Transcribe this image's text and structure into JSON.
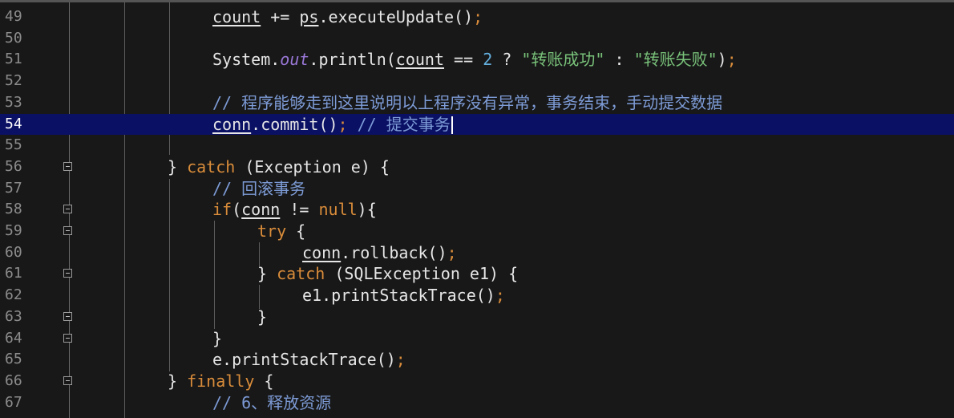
{
  "editor": {
    "current_line": "54",
    "lines": [
      {
        "n": "49",
        "t1": "count",
        "t2": " += ",
        "t3": "ps",
        "t4": ".executeUpdate()",
        "t5": ";"
      },
      {
        "n": "50"
      },
      {
        "n": "51",
        "t1": "System.",
        "t2": "out",
        "t3": ".println(",
        "t4": "count",
        "t5": " == ",
        "t6": "2",
        "t7": " ? ",
        "t8": "\"转账成功\"",
        "t9": " : ",
        "t10": "\"转账失败\"",
        "t11": ")",
        "t12": ";"
      },
      {
        "n": "52"
      },
      {
        "n": "53",
        "c": "// 程序能够走到这里说明以上程序没有异常，事务结束，手动提交数据"
      },
      {
        "n": "54",
        "t1": "conn",
        "t2": ".commit()",
        "t3": ";",
        "c": " // 提交事务"
      },
      {
        "n": "55"
      },
      {
        "n": "56",
        "t1": "} ",
        "t2": "catch",
        "t3": " (Exception e) {"
      },
      {
        "n": "57",
        "c": "// 回滚事务"
      },
      {
        "n": "58",
        "t1": "if",
        "t2": "(",
        "t3": "conn",
        "t4": " != ",
        "t5": "null",
        "t6": "){"
      },
      {
        "n": "59",
        "t1": "try",
        "t2": " {"
      },
      {
        "n": "60",
        "t1": "conn",
        "t2": ".rollback()",
        "t3": ";"
      },
      {
        "n": "61",
        "t1": "} ",
        "t2": "catch",
        "t3": " (SQLException e1) {"
      },
      {
        "n": "62",
        "t1": "e1.printStackTrace()",
        "t2": ";"
      },
      {
        "n": "63",
        "t1": "}"
      },
      {
        "n": "64",
        "t1": "}"
      },
      {
        "n": "65",
        "t1": "e.printStackTrace()",
        "t2": ";"
      },
      {
        "n": "66",
        "t1": "} ",
        "t2": "finally",
        "t3": " {"
      },
      {
        "n": "67",
        "c": "// 6、释放资源"
      }
    ]
  },
  "colors": {
    "background": "#181818",
    "current_line": "#0a1064",
    "keyword": "#d98c3a",
    "string": "#79c27a",
    "comment": "#7d9bd6",
    "number": "#64b0e0",
    "field": "#9a78d8"
  }
}
